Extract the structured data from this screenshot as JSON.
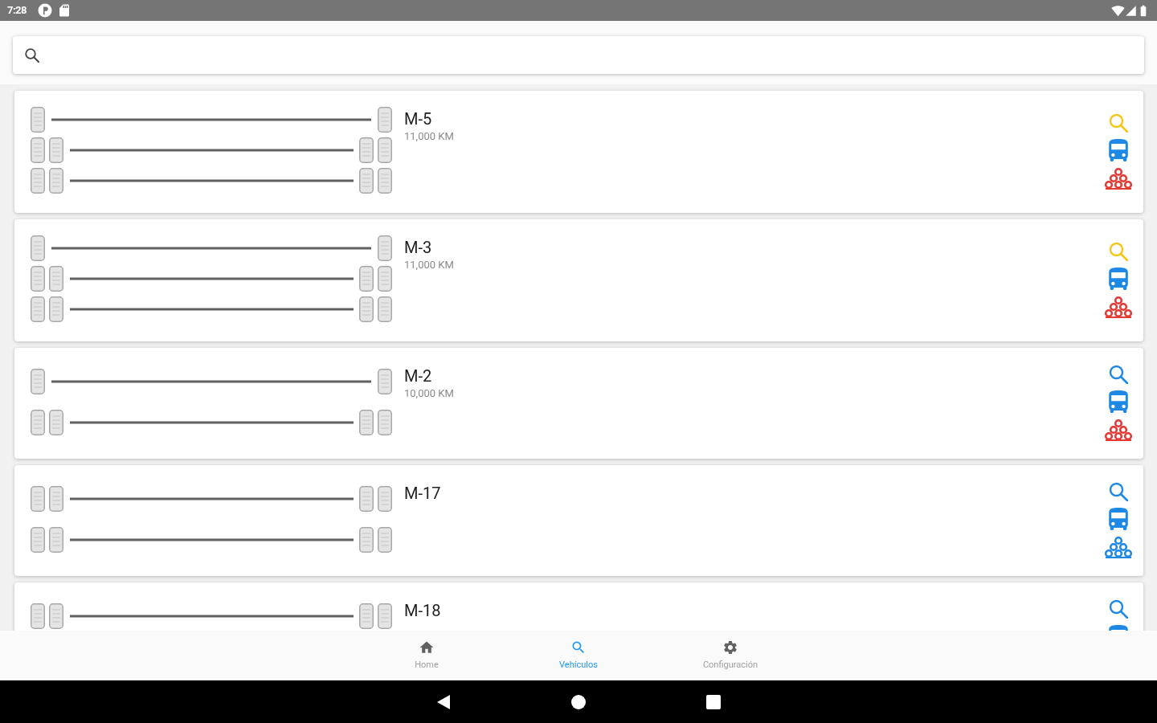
{
  "status_bar": {
    "time": "7:28"
  },
  "vehicles": [
    {
      "name": "M-5",
      "odometer": "11,000 KM",
      "axles": [
        {
          "kind": "single"
        },
        {
          "kind": "dual"
        },
        {
          "kind": "dual"
        }
      ],
      "actions": [
        {
          "kind": "search",
          "color": "#f5c518"
        },
        {
          "kind": "bus",
          "color": "#1e88e5"
        },
        {
          "kind": "tires",
          "color": "#e53935"
        }
      ]
    },
    {
      "name": "M-3",
      "odometer": "11,000 KM",
      "axles": [
        {
          "kind": "single"
        },
        {
          "kind": "dual"
        },
        {
          "kind": "dual"
        }
      ],
      "actions": [
        {
          "kind": "search",
          "color": "#f5c518"
        },
        {
          "kind": "bus",
          "color": "#1e88e5"
        },
        {
          "kind": "tires",
          "color": "#e53935"
        }
      ]
    },
    {
      "name": "M-2",
      "odometer": "10,000 KM",
      "axles": [
        {
          "kind": "single"
        },
        {
          "kind": "dual"
        }
      ],
      "actions": [
        {
          "kind": "search",
          "color": "#1e88e5"
        },
        {
          "kind": "bus",
          "color": "#1e88e5"
        },
        {
          "kind": "tires",
          "color": "#e53935"
        }
      ]
    },
    {
      "name": "M-17",
      "axles": [
        {
          "kind": "dual"
        },
        {
          "kind": "dual"
        }
      ],
      "actions": [
        {
          "kind": "search",
          "color": "#1e88e5"
        },
        {
          "kind": "bus",
          "color": "#1e88e5"
        },
        {
          "kind": "tires",
          "color": "#1e88e5"
        }
      ]
    },
    {
      "name": "M-18",
      "axles": [
        {
          "kind": "dual"
        }
      ],
      "actions": [
        {
          "kind": "search",
          "color": "#1e88e5"
        },
        {
          "kind": "bus",
          "color": "#1e88e5"
        }
      ]
    }
  ],
  "bottom_nav": [
    {
      "kind": "home",
      "label": "Home",
      "selected": false
    },
    {
      "kind": "search",
      "label": "Vehículos",
      "selected": true
    },
    {
      "kind": "settings",
      "label": "Configuración",
      "selected": false
    }
  ]
}
